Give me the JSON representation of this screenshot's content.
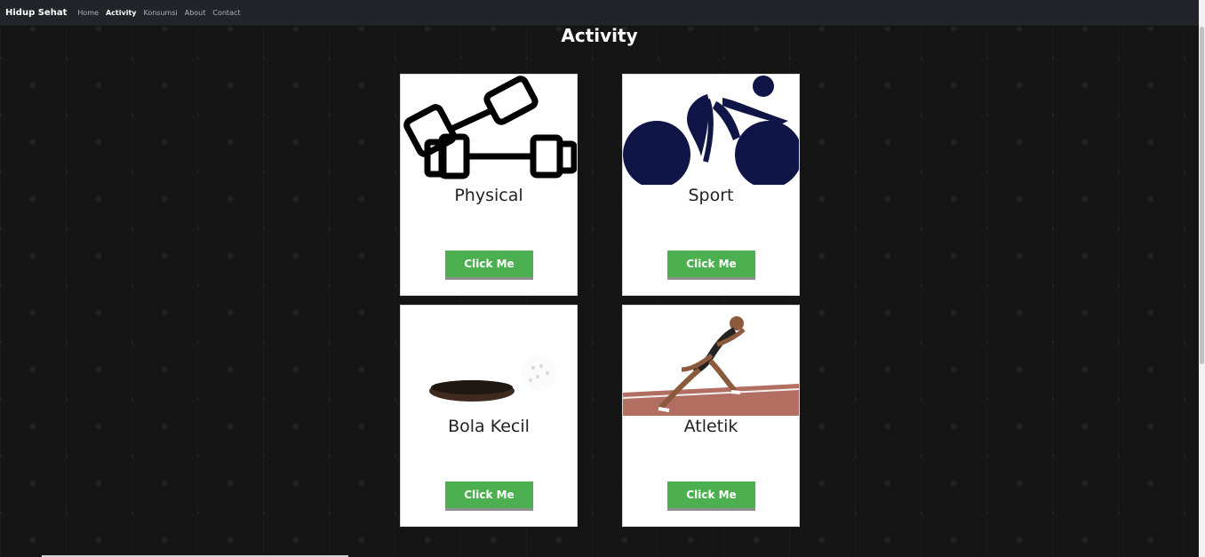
{
  "navbar": {
    "brand": "Hidup Sehat",
    "links": [
      {
        "label": "Home",
        "active": false
      },
      {
        "label": "Activity",
        "active": true
      },
      {
        "label": "Konsumsi",
        "active": false
      },
      {
        "label": "About",
        "active": false
      },
      {
        "label": "Contact",
        "active": false
      }
    ]
  },
  "page": {
    "title": "Activity"
  },
  "cards": [
    {
      "title": "Physical",
      "button": "Click Me",
      "image": "dumbbell-icon"
    },
    {
      "title": "Sport",
      "button": "Click Me",
      "image": "cycling-icon"
    },
    {
      "title": "Bola Kecil",
      "button": "Click Me",
      "image": "golf-ball-photo"
    },
    {
      "title": "Atletik",
      "button": "Click Me",
      "image": "sprinter-photo"
    }
  ],
  "colors": {
    "navbar": "#212529",
    "button": "#4caf50",
    "card": "#ffffff",
    "text": "#222222"
  }
}
